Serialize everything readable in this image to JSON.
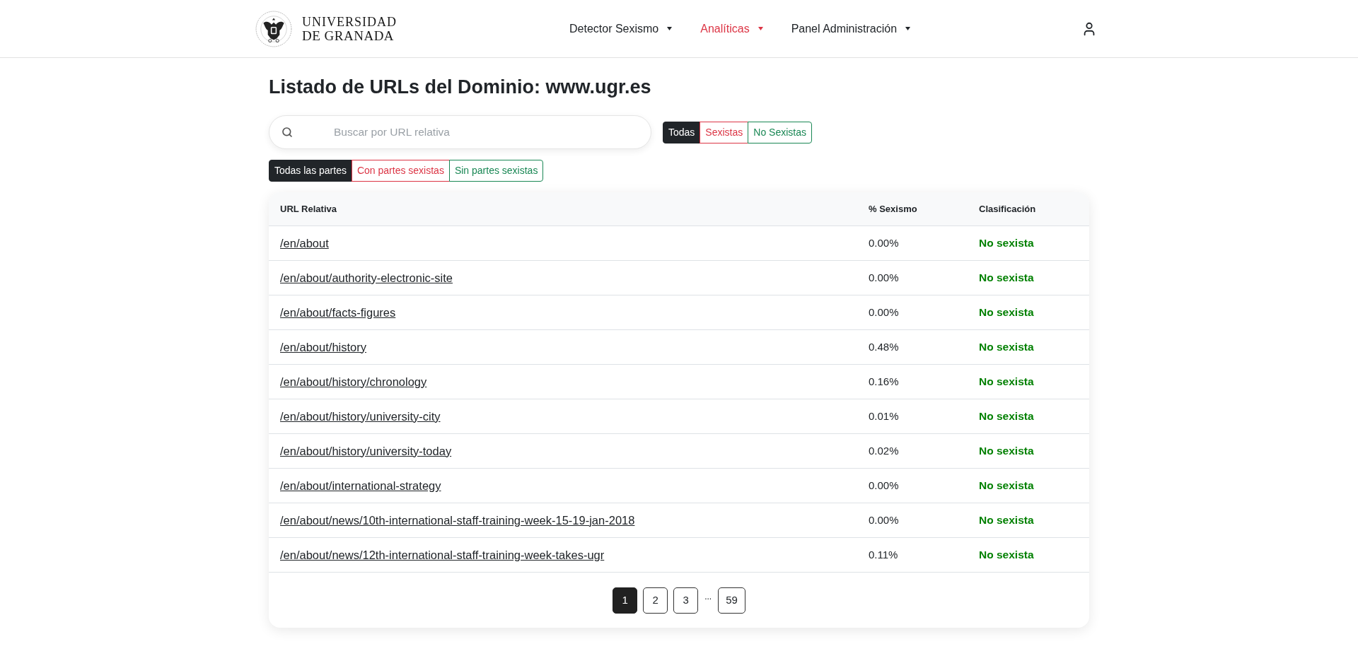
{
  "header": {
    "logo": {
      "line_1": "UNIVERSIDAD",
      "line_2": "DE GRANADA"
    },
    "nav": [
      {
        "label": "Detector Sexismo",
        "selected": false
      },
      {
        "label": "Analíticas",
        "selected": true
      },
      {
        "label": "Panel Administración",
        "selected": false
      }
    ]
  },
  "title": "Listado de URLs del Dominio: www.ugr.es",
  "search": {
    "placeholder": "Buscar por URL relativa"
  },
  "classification_filter": [
    {
      "label": "Todas",
      "kind": "all",
      "selected": true
    },
    {
      "label": "Sexistas",
      "kind": "sexist",
      "selected": false
    },
    {
      "label": "No Sexistas",
      "kind": "non_sexist",
      "selected": false
    }
  ],
  "parts_filter": [
    {
      "label": "Todas las partes",
      "kind": "all",
      "selected": true
    },
    {
      "label": "Con partes sexistas",
      "kind": "sexist",
      "selected": false
    },
    {
      "label": "Sin partes sexistas",
      "kind": "non_sexist",
      "selected": false
    }
  ],
  "table": {
    "columns": [
      "URL Relativa",
      "% Sexismo",
      "Clasificación"
    ],
    "rows": [
      {
        "url": "/en/about",
        "percent": "0.00%",
        "classification": "No sexista",
        "sexist": false
      },
      {
        "url": "/en/about/authority-electronic-site",
        "percent": "0.00%",
        "classification": "No sexista",
        "sexist": false
      },
      {
        "url": "/en/about/facts-figures",
        "percent": "0.00%",
        "classification": "No sexista",
        "sexist": false
      },
      {
        "url": "/en/about/history",
        "percent": "0.48%",
        "classification": "No sexista",
        "sexist": false
      },
      {
        "url": "/en/about/history/chronology",
        "percent": "0.16%",
        "classification": "No sexista",
        "sexist": false
      },
      {
        "url": "/en/about/history/university-city",
        "percent": "0.01%",
        "classification": "No sexista",
        "sexist": false
      },
      {
        "url": "/en/about/history/university-today",
        "percent": "0.02%",
        "classification": "No sexista",
        "sexist": false
      },
      {
        "url": "/en/about/international-strategy",
        "percent": "0.00%",
        "classification": "No sexista",
        "sexist": false
      },
      {
        "url": "/en/about/news/10th-international-staff-training-week-15-19-jan-2018",
        "percent": "0.00%",
        "classification": "No sexista",
        "sexist": false
      },
      {
        "url": "/en/about/news/12th-international-staff-training-week-takes-ugr",
        "percent": "0.11%",
        "classification": "No sexista",
        "sexist": false
      }
    ]
  },
  "pagination": [
    {
      "label": "1",
      "kind": "page",
      "selected": true
    },
    {
      "label": "2",
      "kind": "page",
      "selected": false
    },
    {
      "label": "3",
      "kind": "page",
      "selected": false
    },
    {
      "label": "...",
      "kind": "ellipsis",
      "selected": false
    },
    {
      "label": "59",
      "kind": "page",
      "selected": false
    }
  ]
}
